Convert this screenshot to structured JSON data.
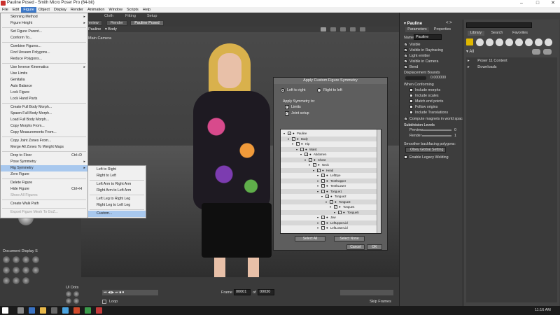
{
  "window": {
    "title": "Pauline Posed - Smith Micro Poser Pro  (64-bit)",
    "controls": [
      "–",
      "□",
      "✕"
    ]
  },
  "menubar": [
    "File",
    "Edit",
    "Figure",
    "Object",
    "Display",
    "Render",
    "Animation",
    "Window",
    "Scripts",
    "Help"
  ],
  "room_tabs": [
    "Cloth",
    "Fitting",
    "Setup"
  ],
  "view_tabs": [
    "Preview",
    "Render",
    "Pauline Posed"
  ],
  "viewport": {
    "figure_label": "Pauline",
    "part_label": "Body",
    "camera_label": "Main Camera"
  },
  "figure_menu": {
    "items": [
      {
        "label": "Skinning Method",
        "sub": true
      },
      {
        "label": "Figure Height",
        "sub": true
      },
      {
        "sep": true
      },
      {
        "label": "Set Figure Parent..."
      },
      {
        "label": "Conform To..."
      },
      {
        "sep": true
      },
      {
        "label": "Combine Figures..."
      },
      {
        "label": "Find Unseen Polygons..."
      },
      {
        "label": "Reduce Polygons..."
      },
      {
        "sep": true
      },
      {
        "label": "Use Inverse Kinematics",
        "sub": true
      },
      {
        "label": "Use Limits"
      },
      {
        "label": "Genitalia"
      },
      {
        "label": "Auto Balance"
      },
      {
        "label": "Lock Figure"
      },
      {
        "label": "Lock Hand Parts"
      },
      {
        "sep": true
      },
      {
        "label": "Create Full Body Morph..."
      },
      {
        "label": "Spawn Full Body Morph..."
      },
      {
        "label": "Load Full Body Morph..."
      },
      {
        "label": "Copy Morphs From..."
      },
      {
        "label": "Copy Measurements From..."
      },
      {
        "sep": true
      },
      {
        "label": "Copy Joint Zones From..."
      },
      {
        "label": "Merge All Zones To Weight Maps"
      },
      {
        "sep": true
      },
      {
        "label": "Drop to Floor",
        "shortcut": "Ctrl+D"
      },
      {
        "label": "Pose Symmetry",
        "sub": true
      },
      {
        "label": "Rig Symmetry",
        "sub": true,
        "highlight": true
      },
      {
        "label": "Zero Figure"
      },
      {
        "sep": true
      },
      {
        "label": "Delete Figure"
      },
      {
        "label": "Hide Figure",
        "shortcut": "Ctrl+H"
      },
      {
        "label": "Show All Figures",
        "disabled": true
      },
      {
        "sep": true
      },
      {
        "label": "Create Walk Path"
      },
      {
        "sep": true
      },
      {
        "label": "Export Figure Mesh To GoZ...",
        "disabled": true
      }
    ]
  },
  "rig_submenu": {
    "items": [
      {
        "label": "Left to Right"
      },
      {
        "label": "Right to Left"
      },
      {
        "sep": true
      },
      {
        "label": "Left Arm to Right Arm"
      },
      {
        "label": "Right Arm to Left Arm"
      },
      {
        "sep": true
      },
      {
        "label": "Left Leg to Right Leg"
      },
      {
        "label": "Right Leg to Left Leg"
      },
      {
        "sep": true
      },
      {
        "label": "Custom...",
        "highlight": true
      }
    ]
  },
  "dialog": {
    "title": "Apply Custom Figure Symmetry",
    "radio_left": "Left to right",
    "radio_right": "Right to left",
    "apply_label": "Apply Symmetry to:",
    "limits": "Limits",
    "joint_setup": "Joint setup",
    "tree": [
      {
        "d": 0,
        "label": "Pauline"
      },
      {
        "d": 1,
        "label": "Body"
      },
      {
        "d": 2,
        "label": "Hip"
      },
      {
        "d": 3,
        "label": "Waist"
      },
      {
        "d": 4,
        "label": "Abdomen"
      },
      {
        "d": 5,
        "label": "Chest"
      },
      {
        "d": 6,
        "label": "Neck"
      },
      {
        "d": 7,
        "label": "Head"
      },
      {
        "d": 8,
        "label": "LeftEye"
      },
      {
        "d": 8,
        "label": "TeethUpper"
      },
      {
        "d": 8,
        "label": "TeethLower"
      },
      {
        "d": 8,
        "label": "Tongue1"
      },
      {
        "d": 9,
        "label": "Tongue2"
      },
      {
        "d": 10,
        "label": "Tongue3"
      },
      {
        "d": 11,
        "label": "Tongue4"
      },
      {
        "d": 12,
        "label": "Tongue5"
      },
      {
        "d": 8,
        "label": "Jaw"
      },
      {
        "d": 8,
        "label": "LeftUpperLid"
      },
      {
        "d": 8,
        "label": "LeftLowerLid"
      }
    ],
    "select_all": "Select All",
    "select_none": "Select None",
    "cancel": "Cancel",
    "ok": "OK"
  },
  "parameters": {
    "figure_dropdown": "Pauline",
    "tab_parameters": "Parameters",
    "tab_properties": "Properties",
    "name_label": "Name",
    "name_value": "Pauline",
    "checkboxes": [
      {
        "label": "Visible",
        "checked": true
      },
      {
        "label": "Visible in Raytracing",
        "checked": true
      },
      {
        "label": "Light emitter",
        "checked": true
      },
      {
        "label": "Visible in Camera",
        "checked": true
      },
      {
        "label": "Bend",
        "checked": true
      }
    ],
    "displacement_label": "Displacement Bounds",
    "displacement_value": "0.000000",
    "conforming_label": "When Conforming",
    "conforming": [
      {
        "label": "Include morphs"
      },
      {
        "label": "Include scales"
      },
      {
        "label": "Match end points"
      },
      {
        "label": "Follow origins"
      },
      {
        "label": "Include Translations"
      }
    ],
    "compute_magnets": "Compute magnets in world space",
    "subdivision_label": "Subdivision Levels",
    "preview_label": "Preview",
    "preview_value": "0",
    "render_label": "Render",
    "render_value": "1",
    "backfacing_label": "Smoother backfacing polygons:",
    "obey_global": "Obey Global Setting",
    "legacy_welding": "Enable Legacy Welding"
  },
  "library": {
    "tab_library": "Library",
    "tab_search": "Search",
    "tab_favorites": "Favorites",
    "all_label": "All",
    "items": [
      "Poser 11 Content",
      "Downloads"
    ]
  },
  "left_panel": {
    "document_display": "Document Display S",
    "ui_dots": "UI Dots"
  },
  "timeline": {
    "frame_label": "Frame",
    "frame_value": "00001",
    "of_label": "of",
    "total_frames": "00030",
    "loop_label": "Loop",
    "skip_frames": "Skip Frames"
  },
  "taskbar": {
    "time": "11:16 AM"
  }
}
